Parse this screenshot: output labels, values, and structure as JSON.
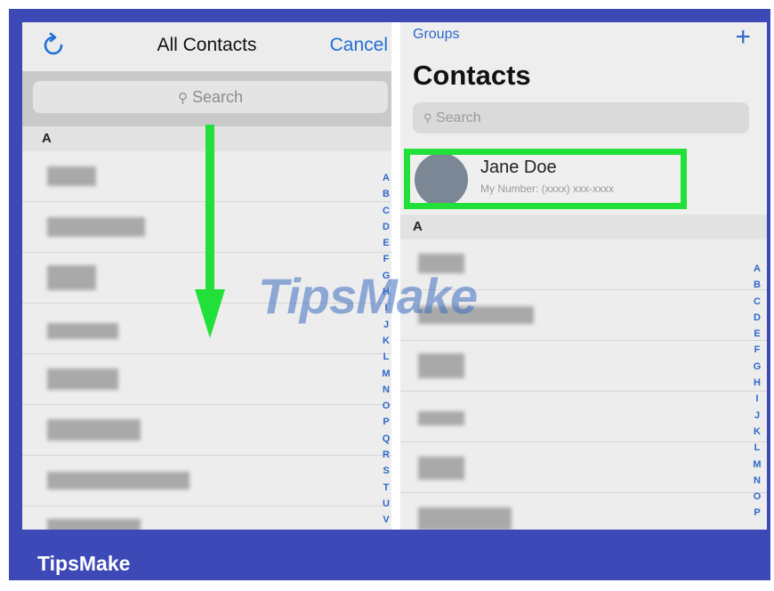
{
  "left": {
    "title": "All Contacts",
    "cancel_label": "Cancel",
    "search_placeholder": "Search",
    "section": "A",
    "index": [
      "A",
      "B",
      "C",
      "D",
      "E",
      "F",
      "G",
      "H",
      "I",
      "J",
      "K",
      "L",
      "M",
      "N",
      "O",
      "P",
      "Q",
      "R",
      "S",
      "T",
      "U",
      "V"
    ]
  },
  "right": {
    "groups_label": "Groups",
    "add_label": "+",
    "title": "Contacts",
    "search_placeholder": "Search",
    "my_card": {
      "name": "Jane Doe",
      "number": "My Number: (xxxx) xxx-xxxx"
    },
    "section": "A",
    "index": [
      "A",
      "B",
      "C",
      "D",
      "E",
      "F",
      "G",
      "H",
      "I",
      "J",
      "K",
      "L",
      "M",
      "N",
      "O",
      "P"
    ]
  },
  "watermark": "TipsMake",
  "brand": "TipsMake",
  "colors": {
    "highlight": "#22e03a",
    "frame": "#3d49b6",
    "link": "#2f67c9"
  }
}
